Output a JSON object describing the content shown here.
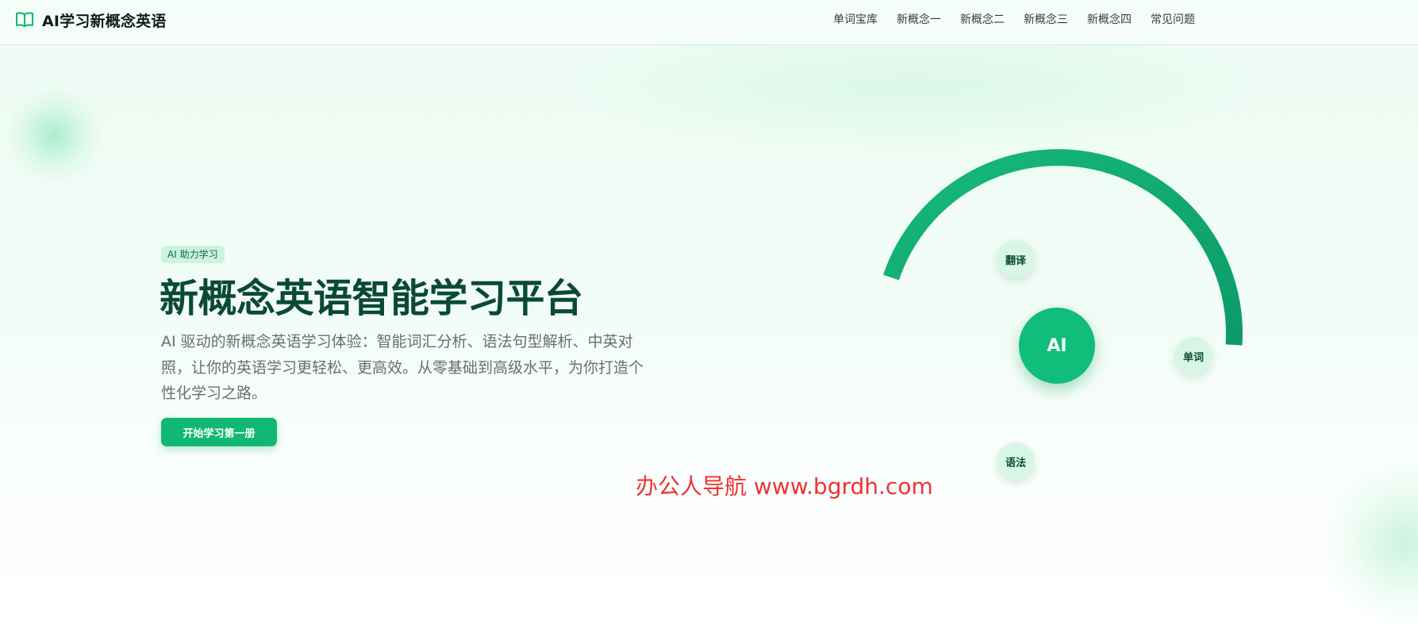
{
  "brand": {
    "name": "AI学习新概念英语",
    "icon": "open-book-icon",
    "accent": "#10b873"
  },
  "nav": {
    "items": [
      {
        "label": "单词宝库"
      },
      {
        "label": "新概念一"
      },
      {
        "label": "新概念二"
      },
      {
        "label": "新概念三"
      },
      {
        "label": "新概念四"
      },
      {
        "label": "常见问题"
      }
    ]
  },
  "hero": {
    "badge": "AI 助力学习",
    "title": "新概念英语智能学习平台",
    "description": "AI 驱动的新概念英语学习体验：智能词汇分析、语法句型解析、中英对照，让你的英语学习更轻松、更高效。从零基础到高级水平，为你打造个性化学习之路。",
    "cta_label": "开始学习第一册"
  },
  "diagram": {
    "core_label": "AI",
    "nodes": {
      "translate": "翻译",
      "word": "单词",
      "grammar": "语法"
    },
    "colors": {
      "arc": "#11a872",
      "core": "#10bd7a",
      "node": "#d7f6e6",
      "title": "#0a4a33"
    }
  },
  "watermark": {
    "text": "办公人导航 www.bgrdh.com",
    "color": "#ee3333"
  }
}
